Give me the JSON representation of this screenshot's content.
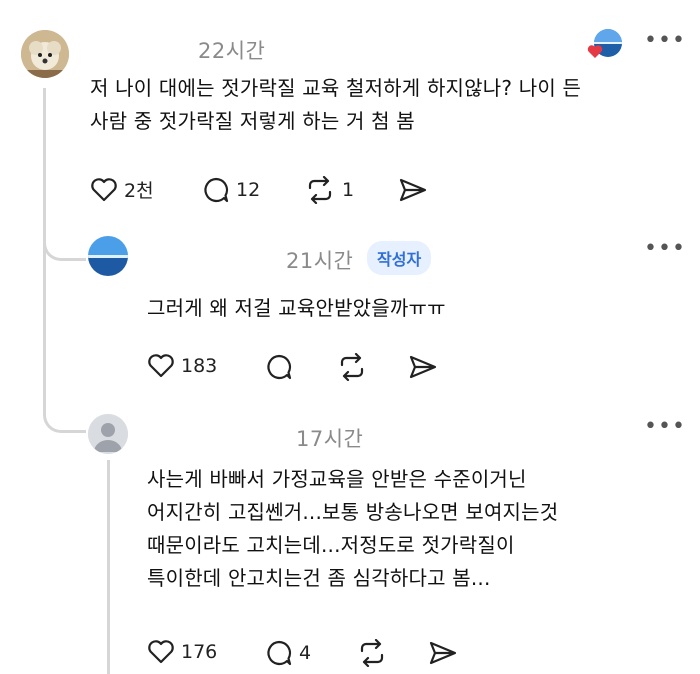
{
  "comments": [
    {
      "time": "22시간",
      "text": "저 나이 대에는 젓가락질 교육 철저하게 하지않나? 나이 든\n사람 중 젓가락질 저렇게 하는 거 첨 봄",
      "likes": "2천",
      "replies": "12",
      "reposts": "1"
    },
    {
      "time": "21시간",
      "badge": "작성자",
      "text": "그러게 왜 저걸 교육안받았을까ㅠㅠ",
      "likes": "183"
    },
    {
      "time": "17시간",
      "text": "사는게 바빠서 가정교육을 안받은 수준이거닌\n어지간히 고집쎈거...보통 방송나오면 보여지는것\n때문이라도 고치는데...저정도로 젓가락질이\n특이한데 안고치는건 좀 심각하다고 봄...",
      "likes": "176",
      "replies": "4"
    }
  ],
  "icons": {
    "like": "heart-icon",
    "reply": "comment-bubble-icon",
    "repost": "repost-icon",
    "share": "send-icon",
    "more": "more-dots-icon",
    "reaction": "heart-reaction-icon"
  },
  "colors": {
    "accent": "#2f6fd6",
    "badge_bg": "#e7f0ff",
    "reaction_heart": "#e53945",
    "muted": "#8a8a8a"
  }
}
